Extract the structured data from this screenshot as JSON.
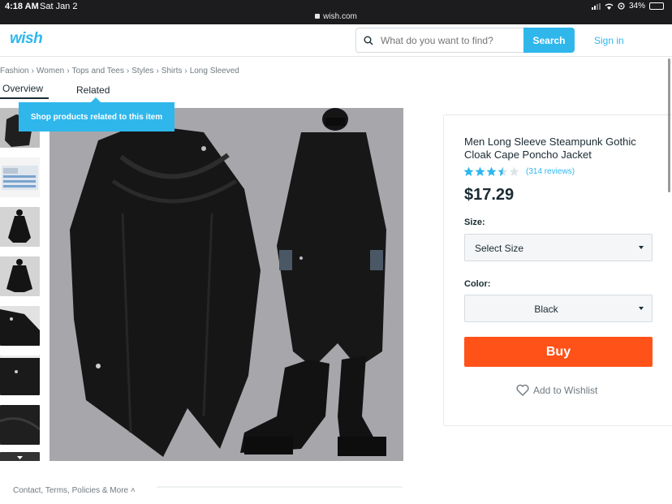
{
  "status_bar": {
    "time": "4:18 AM",
    "date": "Sat Jan 2",
    "url": "wish.com",
    "battery": "34%",
    "battery_level": 0.34
  },
  "header": {
    "logo": "wish",
    "search_placeholder": "What do you want to find?",
    "search_button": "Search",
    "sign_in": "Sign in"
  },
  "breadcrumb": [
    "Fashion",
    "Women",
    "Tops and Tees",
    "Styles",
    "Shirts",
    "Long Sleeved"
  ],
  "tabs": {
    "overview": "Overview",
    "related": "Related"
  },
  "tooltip": "Shop products related to this item",
  "product": {
    "title": "Men Long Sleeve Steampunk Gothic Cloak Cape Poncho Jacket",
    "rating": 3.5,
    "rating_max": 5,
    "reviews": "(314 reviews)",
    "price": "$17.29",
    "size_label": "Size:",
    "size_value": "Select Size",
    "color_label": "Color:",
    "color_value": "Black",
    "buy_label": "Buy",
    "wishlist_label": "Add to Wishlist"
  },
  "footer": {
    "link": "Contact, Terms, Policies & More"
  },
  "colors": {
    "brand": "#2fb7ec",
    "buy": "#ff5218",
    "text": "#192a32",
    "muted": "#6f7a80"
  },
  "icons": {
    "search": "search-icon",
    "wishlist": "heart-icon",
    "select_caret": "caret-down-icon",
    "footer_caret": "chevron-up-icon"
  }
}
